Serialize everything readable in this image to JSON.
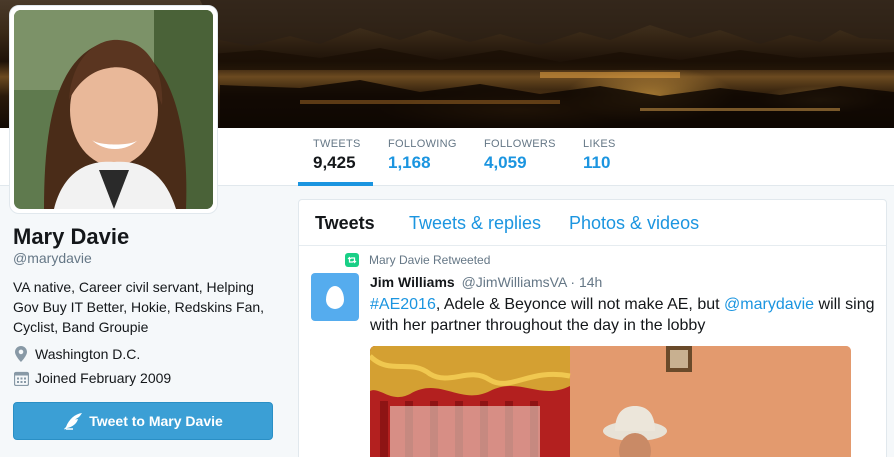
{
  "profile": {
    "name": "Mary Davie",
    "handle": "@marydavie",
    "bio": "VA native, Career civil servant, Helping Gov Buy IT Better, Hokie, Redskins Fan, Cyclist, Band Groupie",
    "location": "Washington D.C.",
    "joined": "Joined February 2009",
    "tweet_to_label": "Tweet to Mary Davie"
  },
  "stats": {
    "tweets_label": "TWEETS",
    "tweets_value": "9,425",
    "following_label": "FOLLOWING",
    "following_value": "1,168",
    "followers_label": "FOLLOWERS",
    "followers_value": "4,059",
    "likes_label": "LIKES",
    "likes_value": "110"
  },
  "timeline": {
    "tabs": [
      {
        "label": "Tweets",
        "active": true
      },
      {
        "label": "Tweets & replies",
        "active": false
      },
      {
        "label": "Photos & videos",
        "active": false
      }
    ],
    "tweet": {
      "retweet_context": "Mary Davie Retweeted",
      "author": "Jim Williams",
      "username": "@JimWilliamsVA",
      "separator": " · ",
      "time": "14h",
      "text_parts": {
        "hashtag": "#AE2016",
        "middle": ", Adele & Beyonce will not make AE, but ",
        "mention": "@marydavie",
        "end": " will sing with her partner throughout the day in the lobby"
      }
    }
  },
  "icons": {
    "location": "map-pin-icon",
    "joined": "calendar-icon",
    "tweet_to": "quill-icon",
    "retweet": "retweet-icon",
    "default_avatar": "egg-icon"
  },
  "colors": {
    "accent": "#1b95e0",
    "button": "#3b9fd5",
    "retweet": "#19cf86"
  }
}
